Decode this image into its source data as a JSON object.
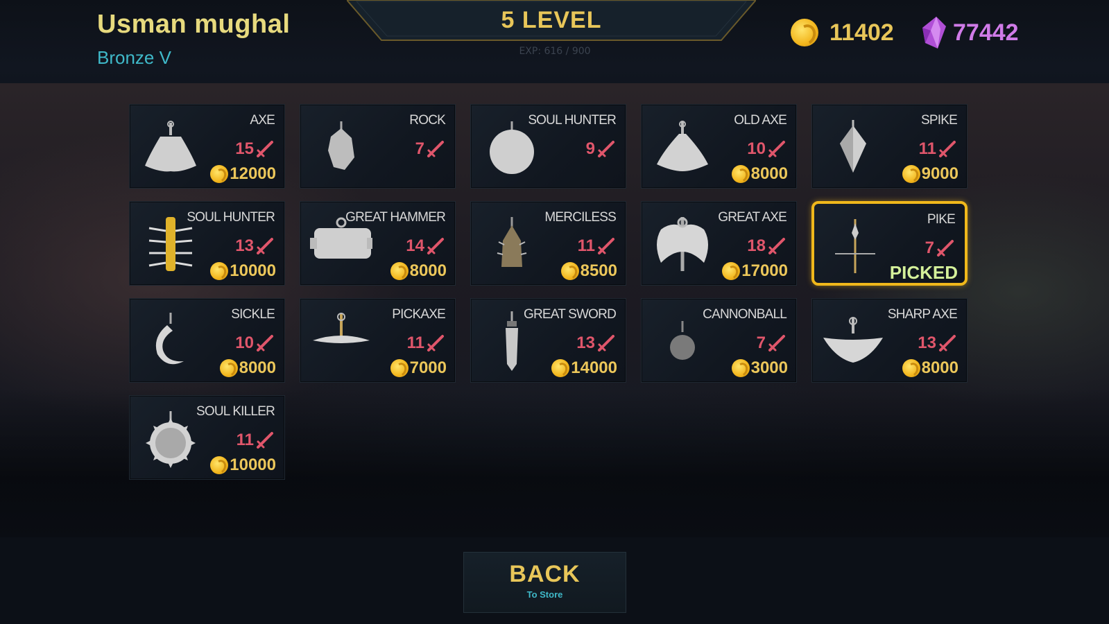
{
  "player": {
    "name": "Usman mughal",
    "rank": "Bronze V"
  },
  "level": {
    "label": "5  LEVEL",
    "exp": "EXP: 616 / 900"
  },
  "currency": {
    "gold": "11402",
    "gems": "77442",
    "gold_icon": "coin-icon",
    "gem_icon": "crystal-icon"
  },
  "weapons": [
    {
      "name": "AXE",
      "damage": "15",
      "price": "12000",
      "picked": false,
      "icon": "axe"
    },
    {
      "name": "ROCK",
      "damage": "7",
      "price": "",
      "picked": false,
      "icon": "rock"
    },
    {
      "name": "SOUL HUNTER",
      "damage": "9",
      "price": "",
      "picked": false,
      "icon": "ball"
    },
    {
      "name": "OLD AXE",
      "damage": "10",
      "price": "8000",
      "picked": false,
      "icon": "oldaxe"
    },
    {
      "name": "SPIKE",
      "damage": "11",
      "price": "9000",
      "picked": false,
      "icon": "spike"
    },
    {
      "name": "SOUL HUNTER",
      "damage": "13",
      "price": "10000",
      "picked": false,
      "icon": "spiked-club"
    },
    {
      "name": "GREAT HAMMER",
      "damage": "14",
      "price": "8000",
      "picked": false,
      "icon": "hammer"
    },
    {
      "name": "MERCILESS",
      "damage": "11",
      "price": "8500",
      "picked": false,
      "icon": "merciless"
    },
    {
      "name": "GREAT AXE",
      "damage": "18",
      "price": "17000",
      "picked": false,
      "icon": "greataxe"
    },
    {
      "name": "PIKE",
      "damage": "7",
      "price": "",
      "picked": true,
      "picked_label": "PICKED",
      "icon": "pike"
    },
    {
      "name": "SICKLE",
      "damage": "10",
      "price": "8000",
      "picked": false,
      "icon": "sickle"
    },
    {
      "name": "PICKAXE",
      "damage": "11",
      "price": "7000",
      "picked": false,
      "icon": "pickaxe"
    },
    {
      "name": "GREAT SWORD",
      "damage": "13",
      "price": "14000",
      "picked": false,
      "icon": "sword"
    },
    {
      "name": "CANNONBALL",
      "damage": "7",
      "price": "3000",
      "picked": false,
      "icon": "cannonball"
    },
    {
      "name": "SHARP AXE",
      "damage": "13",
      "price": "8000",
      "picked": false,
      "icon": "sharpaxe"
    },
    {
      "name": "SOUL KILLER",
      "damage": "11",
      "price": "10000",
      "picked": false,
      "icon": "soulkiller"
    }
  ],
  "back_button": {
    "label": "BACK",
    "sublabel": "To Store"
  },
  "colors": {
    "gold_text": "#e8c659",
    "damage_text": "#e0566b",
    "rank_text": "#3fb9c9",
    "gem_text": "#d07be8",
    "picked_border": "#f0b81b",
    "picked_text": "#d4f09a"
  }
}
